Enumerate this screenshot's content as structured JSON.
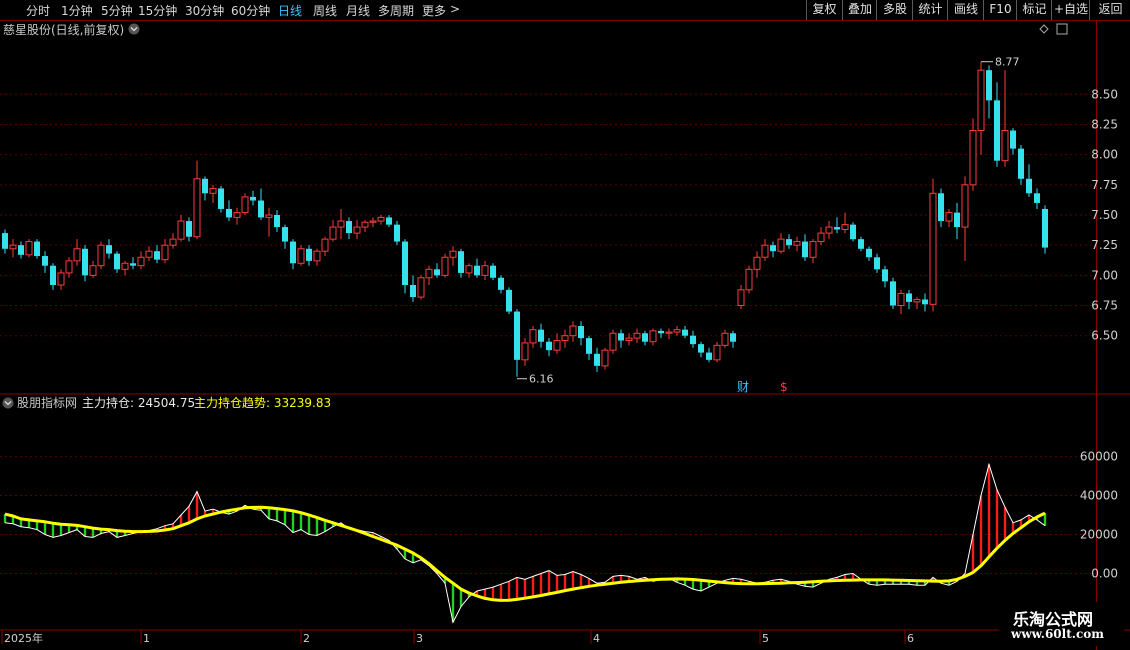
{
  "toolbar": {
    "periods": [
      "分时",
      "1分钟",
      "5分钟",
      "15分钟",
      "30分钟",
      "60分钟",
      "日线",
      "周线",
      "月线",
      "多周期",
      "更多"
    ],
    "active": "日线",
    "more_arrow": ">",
    "right_buttons": [
      "复权",
      "叠加",
      "多股",
      "统计",
      "画线",
      "F10",
      "标记",
      "+自选",
      "返回"
    ]
  },
  "price_panel": {
    "title": "慈星股份(日线,前复权)",
    "high_label": "8.77",
    "low_label": "6.16",
    "markers": {
      "cai": "财",
      "dollar": "$"
    }
  },
  "indicator_panel": {
    "title": "股朋指标网",
    "main_label": "主力持仓: 24504.75",
    "trend_label": "主力持仓趋势: 33239.83"
  },
  "x_axis": {
    "labels": [
      "2025年",
      "1",
      "2",
      "3",
      "4",
      "5",
      "6"
    ]
  },
  "watermark": {
    "line1": "乐淘公式网",
    "line2": "www.60lt.com"
  },
  "colors": {
    "up": "#ff3a3a",
    "down": "#35e0f0",
    "trend": "#ffff00",
    "grid": "#5a0000",
    "hold": "#ffffff",
    "pos_bar": "#ff1a1a",
    "neg_bar": "#1fd11f"
  },
  "chart_data": [
    {
      "type": "candlestick",
      "title": "慈星股份(日线,前复权)",
      "y_ticks": [
        6.5,
        6.75,
        7.0,
        7.25,
        7.5,
        7.75,
        8.0,
        8.25,
        8.5
      ],
      "ylim": [
        6.05,
        8.95
      ],
      "candles": [
        [
          7.35,
          7.38,
          7.18,
          7.22
        ],
        [
          7.22,
          7.3,
          7.15,
          7.25
        ],
        [
          7.25,
          7.28,
          7.14,
          7.17
        ],
        [
          7.17,
          7.3,
          7.15,
          7.28
        ],
        [
          7.28,
          7.3,
          7.14,
          7.16
        ],
        [
          7.16,
          7.2,
          7.02,
          7.08
        ],
        [
          7.08,
          7.1,
          6.88,
          6.92
        ],
        [
          6.92,
          7.05,
          6.88,
          7.02
        ],
        [
          7.02,
          7.15,
          6.98,
          7.12
        ],
        [
          7.12,
          7.3,
          7.08,
          7.22
        ],
        [
          7.22,
          7.25,
          6.95,
          7.0
        ],
        [
          7.0,
          7.12,
          6.98,
          7.08
        ],
        [
          7.08,
          7.28,
          7.05,
          7.25
        ],
        [
          7.25,
          7.3,
          7.14,
          7.18
        ],
        [
          7.18,
          7.2,
          7.02,
          7.05
        ],
        [
          7.05,
          7.12,
          7.0,
          7.1
        ],
        [
          7.1,
          7.15,
          7.05,
          7.08
        ],
        [
          7.08,
          7.2,
          7.05,
          7.15
        ],
        [
          7.15,
          7.24,
          7.12,
          7.2
        ],
        [
          7.2,
          7.25,
          7.1,
          7.13
        ],
        [
          7.13,
          7.3,
          7.1,
          7.25
        ],
        [
          7.25,
          7.35,
          7.22,
          7.3
        ],
        [
          7.3,
          7.5,
          7.28,
          7.45
        ],
        [
          7.45,
          7.48,
          7.28,
          7.32
        ],
        [
          7.32,
          7.95,
          7.3,
          7.8
        ],
        [
          7.8,
          7.82,
          7.62,
          7.68
        ],
        [
          7.68,
          7.75,
          7.6,
          7.72
        ],
        [
          7.72,
          7.74,
          7.52,
          7.55
        ],
        [
          7.55,
          7.62,
          7.45,
          7.48
        ],
        [
          7.48,
          7.56,
          7.42,
          7.52
        ],
        [
          7.52,
          7.68,
          7.5,
          7.65
        ],
        [
          7.65,
          7.7,
          7.58,
          7.62
        ],
        [
          7.62,
          7.72,
          7.46,
          7.48
        ],
        [
          7.48,
          7.56,
          7.32,
          7.5
        ],
        [
          7.5,
          7.54,
          7.36,
          7.4
        ],
        [
          7.4,
          7.42,
          7.22,
          7.28
        ],
        [
          7.28,
          7.3,
          7.05,
          7.1
        ],
        [
          7.1,
          7.25,
          7.08,
          7.22
        ],
        [
          7.22,
          7.25,
          7.08,
          7.12
        ],
        [
          7.12,
          7.22,
          7.08,
          7.2
        ],
        [
          7.2,
          7.32,
          7.16,
          7.3
        ],
        [
          7.3,
          7.46,
          7.28,
          7.4
        ],
        [
          7.4,
          7.55,
          7.3,
          7.45
        ],
        [
          7.45,
          7.48,
          7.3,
          7.35
        ],
        [
          7.35,
          7.46,
          7.3,
          7.4
        ],
        [
          7.4,
          7.46,
          7.36,
          7.44
        ],
        [
          7.44,
          7.48,
          7.4,
          7.45
        ],
        [
          7.45,
          7.5,
          7.42,
          7.48
        ],
        [
          7.48,
          7.5,
          7.4,
          7.42
        ],
        [
          7.42,
          7.45,
          7.25,
          7.28
        ],
        [
          7.28,
          7.3,
          6.85,
          6.92
        ],
        [
          6.92,
          7.0,
          6.78,
          6.82
        ],
        [
          6.82,
          7.0,
          6.8,
          6.98
        ],
        [
          6.98,
          7.08,
          6.92,
          7.05
        ],
        [
          7.05,
          7.1,
          6.98,
          7.0
        ],
        [
          7.0,
          7.18,
          6.98,
          7.15
        ],
        [
          7.15,
          7.24,
          7.08,
          7.2
        ],
        [
          7.2,
          7.22,
          6.98,
          7.02
        ],
        [
          7.02,
          7.1,
          6.98,
          7.08
        ],
        [
          7.08,
          7.14,
          6.98,
          7.0
        ],
        [
          7.0,
          7.12,
          6.96,
          7.08
        ],
        [
          7.08,
          7.1,
          6.96,
          6.98
        ],
        [
          6.98,
          7.0,
          6.85,
          6.88
        ],
        [
          6.88,
          6.9,
          6.68,
          6.7
        ],
        [
          6.7,
          6.72,
          6.16,
          6.3
        ],
        [
          6.3,
          6.48,
          6.25,
          6.44
        ],
        [
          6.44,
          6.58,
          6.4,
          6.55
        ],
        [
          6.55,
          6.6,
          6.4,
          6.45
        ],
        [
          6.45,
          6.48,
          6.33,
          6.38
        ],
        [
          6.38,
          6.52,
          6.35,
          6.46
        ],
        [
          6.46,
          6.55,
          6.4,
          6.5
        ],
        [
          6.5,
          6.62,
          6.45,
          6.58
        ],
        [
          6.58,
          6.62,
          6.42,
          6.48
        ],
        [
          6.48,
          6.5,
          6.3,
          6.35
        ],
        [
          6.35,
          6.4,
          6.2,
          6.25
        ],
        [
          6.25,
          6.4,
          6.22,
          6.38
        ],
        [
          6.38,
          6.55,
          6.35,
          6.52
        ],
        [
          6.52,
          6.55,
          6.4,
          6.46
        ],
        [
          6.46,
          6.52,
          6.42,
          6.48
        ],
        [
          6.48,
          6.56,
          6.44,
          6.52
        ],
        [
          6.52,
          6.54,
          6.42,
          6.45
        ],
        [
          6.45,
          6.56,
          6.42,
          6.54
        ],
        [
          6.54,
          6.56,
          6.48,
          6.52
        ],
        [
          6.52,
          6.56,
          6.47,
          6.53
        ],
        [
          6.53,
          6.58,
          6.5,
          6.55
        ],
        [
          6.55,
          6.58,
          6.48,
          6.5
        ],
        [
          6.5,
          6.54,
          6.4,
          6.43
        ],
        [
          6.43,
          6.45,
          6.32,
          6.36
        ],
        [
          6.36,
          6.4,
          6.28,
          6.3
        ],
        [
          6.3,
          6.45,
          6.28,
          6.42
        ],
        [
          6.42,
          6.55,
          6.4,
          6.52
        ],
        [
          6.52,
          6.54,
          6.4,
          6.45
        ],
        [
          6.75,
          6.92,
          6.72,
          6.88
        ],
        [
          6.88,
          7.08,
          6.85,
          7.05
        ],
        [
          7.05,
          7.2,
          6.98,
          7.15
        ],
        [
          7.15,
          7.3,
          7.12,
          7.25
        ],
        [
          7.25,
          7.28,
          7.15,
          7.2
        ],
        [
          7.2,
          7.35,
          7.18,
          7.3
        ],
        [
          7.3,
          7.34,
          7.22,
          7.25
        ],
        [
          7.25,
          7.32,
          7.2,
          7.28
        ],
        [
          7.28,
          7.34,
          7.12,
          7.15
        ],
        [
          7.15,
          7.3,
          7.1,
          7.28
        ],
        [
          7.28,
          7.4,
          7.25,
          7.35
        ],
        [
          7.35,
          7.45,
          7.3,
          7.4
        ],
        [
          7.4,
          7.48,
          7.35,
          7.38
        ],
        [
          7.38,
          7.52,
          7.35,
          7.42
        ],
        [
          7.42,
          7.44,
          7.28,
          7.3
        ],
        [
          7.3,
          7.32,
          7.2,
          7.22
        ],
        [
          7.22,
          7.24,
          7.12,
          7.15
        ],
        [
          7.15,
          7.18,
          7.02,
          7.05
        ],
        [
          7.05,
          7.08,
          6.9,
          6.95
        ],
        [
          6.95,
          6.98,
          6.72,
          6.75
        ],
        [
          6.75,
          6.88,
          6.68,
          6.85
        ],
        [
          6.85,
          6.88,
          6.72,
          6.78
        ],
        [
          6.78,
          6.82,
          6.72,
          6.8
        ],
        [
          6.8,
          6.85,
          6.7,
          6.76
        ],
        [
          6.76,
          7.8,
          6.7,
          7.68
        ],
        [
          7.68,
          7.72,
          7.4,
          7.45
        ],
        [
          7.45,
          7.55,
          7.4,
          7.52
        ],
        [
          7.52,
          7.6,
          7.3,
          7.4
        ],
        [
          7.4,
          7.82,
          7.12,
          7.75
        ],
        [
          7.75,
          8.3,
          7.7,
          8.2
        ],
        [
          8.2,
          8.77,
          8.0,
          8.7
        ],
        [
          8.7,
          8.74,
          8.3,
          8.45
        ],
        [
          8.45,
          8.6,
          7.9,
          7.95
        ],
        [
          7.95,
          8.7,
          7.9,
          8.2
        ],
        [
          8.2,
          8.22,
          8.0,
          8.05
        ],
        [
          8.05,
          8.08,
          7.75,
          7.8
        ],
        [
          7.8,
          7.92,
          7.65,
          7.68
        ],
        [
          7.68,
          7.72,
          7.55,
          7.6
        ],
        [
          7.55,
          7.58,
          7.18,
          7.23
        ]
      ]
    },
    {
      "type": "indicator",
      "title": "股朋指标网",
      "series": [
        {
          "name": "主力持仓",
          "values": [
            26000,
            25500,
            24000,
            23500,
            22500,
            20000,
            18500,
            19500,
            21000,
            22500,
            19000,
            18500,
            20500,
            21500,
            18500,
            19500,
            20500,
            21500,
            22000,
            23000,
            24500,
            25500,
            30000,
            34500,
            42000,
            32000,
            33000,
            31500,
            30500,
            32000,
            35000,
            33000,
            32500,
            28000,
            27000,
            25000,
            21000,
            22500,
            20000,
            19500,
            21500,
            24000,
            26000,
            23000,
            22500,
            21500,
            21000,
            19000,
            17000,
            12500,
            7500,
            5500,
            7000,
            4000,
            0,
            -5000,
            -25000,
            -17000,
            -12000,
            -9000,
            -8000,
            -7000,
            -5500,
            -4000,
            -2000,
            -3000,
            -1500,
            0,
            1500,
            -1000,
            -500,
            1000,
            -500,
            -2500,
            -5000,
            -4500,
            -1500,
            -1000,
            -1500,
            -3000,
            -2000,
            -4000,
            -3000,
            -2500,
            -4500,
            -6000,
            -8000,
            -9000,
            -7000,
            -5000,
            -3500,
            -2500,
            -3000,
            -4000,
            -5000,
            -4500,
            -3500,
            -3000,
            -4000,
            -5500,
            -6500,
            -7000,
            -5000,
            -3000,
            -2000,
            -500,
            0,
            -3000,
            -5500,
            -6000,
            -5500,
            -5500,
            -5500,
            -5500,
            -6000,
            -6000,
            -2000,
            -5000,
            -6000,
            -4000,
            0,
            20000,
            40000,
            56000,
            43000,
            34000,
            26000,
            27500,
            30000,
            27500,
            24500
          ]
        },
        {
          "name": "主力持仓趋势",
          "values": [
            30500,
            29500,
            28000,
            27500,
            27000,
            26500,
            25800,
            25300,
            25000,
            24700,
            24000,
            23300,
            22800,
            22500,
            22000,
            21700,
            21500,
            21500,
            21600,
            21800,
            22300,
            23000,
            24500,
            26000,
            28000,
            29500,
            30500,
            31500,
            32300,
            33000,
            33700,
            33900,
            34000,
            33700,
            33300,
            32800,
            32100,
            31200,
            30000,
            28700,
            27300,
            26000,
            24700,
            23400,
            22000,
            20500,
            19000,
            17500,
            16000,
            14500,
            12500,
            10500,
            8000,
            5000,
            1500,
            -2000,
            -5000,
            -8000,
            -10000,
            -11500,
            -12800,
            -13500,
            -13800,
            -13700,
            -13300,
            -12700,
            -12000,
            -11300,
            -10500,
            -9700,
            -8800,
            -8000,
            -7300,
            -6600,
            -6000,
            -5500,
            -5000,
            -4500,
            -4100,
            -3800,
            -3500,
            -3200,
            -3000,
            -2900,
            -2800,
            -2900,
            -3100,
            -3500,
            -3900,
            -4300,
            -4700,
            -5000,
            -5200,
            -5300,
            -5300,
            -5200,
            -5100,
            -5000,
            -4800,
            -4700,
            -4500,
            -4200,
            -4000,
            -3800,
            -3600,
            -3500,
            -3400,
            -3300,
            -3300,
            -3300,
            -3300,
            -3400,
            -3500,
            -3600,
            -3700,
            -3800,
            -3900,
            -4000,
            -3800,
            -3000,
            -1500,
            500,
            4000,
            8500,
            13000,
            17000,
            20500,
            23500,
            26500,
            29000,
            31000,
            32500,
            33240
          ]
        }
      ],
      "y_ticks": [
        0,
        20000,
        40000,
        60000
      ],
      "ylim": [
        -29000,
        88000
      ]
    }
  ]
}
